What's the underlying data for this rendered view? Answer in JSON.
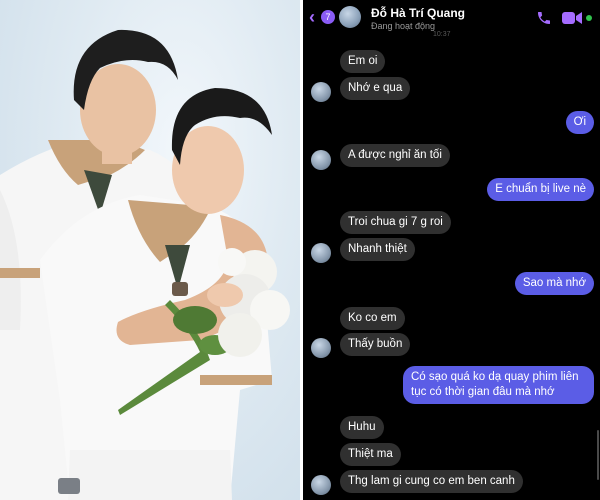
{
  "photo": {
    "alt": "photo",
    "colors": {
      "background": "#dfeaf2",
      "shirt": "#f6f6f6",
      "collar": "#c8a27a",
      "collar_inner": "#3e4a3c",
      "hair": "#1e1e1e",
      "skin": "#e9c2a3",
      "flowers": "#f4f4f0",
      "leaves": "#5b8a3c"
    }
  },
  "chat": {
    "header": {
      "back_icon": "chevron-left-icon",
      "unread_count": "7",
      "contact_name": "Đỗ Hà Trí Quang",
      "status": "Đang hoạt động",
      "timestamp": "10:37",
      "call_icon": "phone-icon",
      "video_icon": "video-camera-icon"
    },
    "messages": [
      {
        "side": "in",
        "text": "Em oi"
      },
      {
        "side": "in",
        "text": "Nhớ e qua"
      },
      {
        "side": "out",
        "text": "Ơi"
      },
      {
        "side": "in",
        "text": "A được nghỉ ăn tối"
      },
      {
        "side": "out",
        "text": "E chuẩn bị live nè"
      },
      {
        "side": "in",
        "text": "Troi chua gi 7 g roi"
      },
      {
        "side": "in",
        "text": "Nhanh thiệt"
      },
      {
        "side": "out",
        "text": "Sao mà nhớ"
      },
      {
        "side": "in",
        "text": "Ko co em"
      },
      {
        "side": "in",
        "text": "Thấy buồn"
      },
      {
        "side": "out",
        "text": "Có sạo quá ko dạ quay phim  liên tục có thời gian đâu mà nhớ"
      },
      {
        "side": "in",
        "text": "Huhu"
      },
      {
        "side": "in",
        "text": "Thiệt ma"
      },
      {
        "side": "in",
        "text": "Thg lam gi cung co em ben canh"
      }
    ],
    "colors": {
      "background": "#000000",
      "incoming": "#303030",
      "outgoing": "#5b5de6",
      "accent": "#a56cff",
      "online": "#31c24d"
    }
  }
}
